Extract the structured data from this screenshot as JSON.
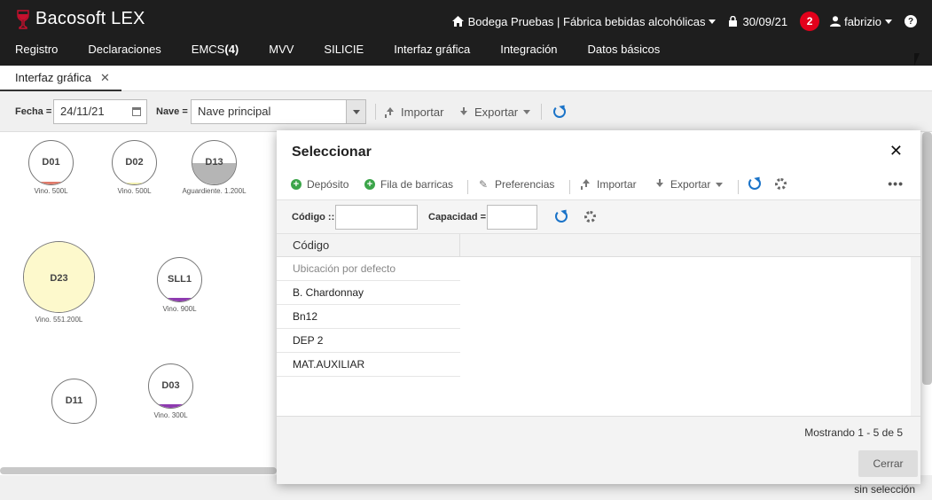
{
  "app": {
    "name": "Bacosoft LEX"
  },
  "header": {
    "bodega": "Bodega Pruebas | Fábrica bebidas alcohólicas",
    "date": "30/09/21",
    "notifications": "2",
    "user": "fabrizio",
    "help": "?"
  },
  "menu": {
    "registro": "Registro",
    "declaraciones": "Declaraciones",
    "emcs_label": "EMCS",
    "emcs_count": "(4)",
    "mvv": "MVV",
    "silicie": "SILICIE",
    "interfaz": "Interfaz gráfica",
    "integracion": "Integración",
    "datos": "Datos básicos"
  },
  "tab": {
    "label": "Interfaz gráfica",
    "close": "✕"
  },
  "toolbar": {
    "fecha_label": "Fecha =",
    "fecha_value": "24/11/21",
    "nave_label": "Nave =",
    "nave_value": "Nave principal",
    "importar": "Importar",
    "exportar": "Exportar"
  },
  "tanks": [
    {
      "name": "D01",
      "capacity": "Vino. 500L",
      "fill_color": "#e07a6a",
      "fill_level": 0.06
    },
    {
      "name": "D02",
      "capacity": "Vino. 500L",
      "fill_color": "#f0eeaa",
      "fill_level": 0.04
    },
    {
      "name": "D13",
      "capacity": "Aguardiente. 1.200L",
      "fill_color": "#b5b5b5",
      "fill_level": 0.5
    },
    {
      "name": "D23",
      "capacity": "Vino. 551.200L",
      "fill_color": "#fdf9cc",
      "fill_level": 1.0
    },
    {
      "name": "SLL1",
      "capacity": "Vino. 900L",
      "fill_color": "#8e3ab0",
      "fill_level": 0.08
    },
    {
      "name": "D11",
      "capacity": "",
      "fill_color": "#ffffff",
      "fill_level": 0
    },
    {
      "name": "D03",
      "capacity": "Vino. 300L",
      "fill_color": "#8e3ab0",
      "fill_level": 0.08
    }
  ],
  "status": {
    "selection": "sin selección"
  },
  "modal": {
    "title": "Seleccionar",
    "close": "✕",
    "actions": {
      "deposito": "Depósito",
      "fila": "Fila de barricas",
      "preferencias": "Preferencias",
      "importar": "Importar",
      "exportar": "Exportar",
      "more": "•••"
    },
    "filters": {
      "codigo_label": "Código ::",
      "codigo_value": "",
      "capacidad_label": "Capacidad =",
      "capacidad_value": ""
    },
    "columns": {
      "codigo": "Código"
    },
    "rows": [
      {
        "codigo": "Ubicación por defecto"
      },
      {
        "codigo": "B. Chardonnay"
      },
      {
        "codigo": "Bn12"
      },
      {
        "codigo": "DEP 2"
      },
      {
        "codigo": "MAT.AUXILIAR"
      }
    ],
    "showing": "Mostrando 1 - 5 de 5",
    "cerrar": "Cerrar"
  },
  "colors": {
    "header_bg": "#1e1e1e",
    "badge": "#e3001b",
    "refresh": "#1a73c8",
    "add": "#3ca54a"
  }
}
